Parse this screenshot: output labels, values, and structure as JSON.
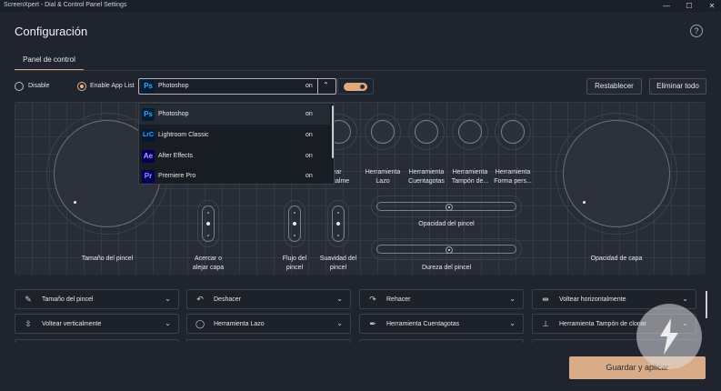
{
  "window": {
    "title": "ScreenXpert - Dial & Control Panel Settings",
    "minimize": "—",
    "maximize": "☐",
    "close": "✕"
  },
  "page": {
    "title": "Configuración",
    "help": "?"
  },
  "tabs": [
    {
      "label": "Panel de control"
    }
  ],
  "mode": {
    "disable_label": "Disable",
    "enable_label": "Enable App List",
    "selected": "enable"
  },
  "app_select": {
    "icon": "Ps",
    "value": "Photoshop",
    "state": "on",
    "chevron": "⌃"
  },
  "toggle": {
    "on": true
  },
  "buttons": {
    "reset": "Restablecer",
    "delete_all": "Eliminar todo",
    "save": "Guardar y aplicar"
  },
  "dropdown": {
    "items": [
      {
        "icon": "Ps",
        "name": "Photoshop",
        "state": "on"
      },
      {
        "icon": "LrC",
        "name": "Lightroom Classic",
        "state": "on"
      },
      {
        "icon": "Ae",
        "name": "After Effects",
        "state": "on"
      },
      {
        "icon": "Pr",
        "name": "Premiere Pro",
        "state": "on"
      }
    ]
  },
  "panel": {
    "left_dial": "Tamaño del pincel",
    "right_dial": "Opacidad de capa",
    "zoom": "Acercar o alejar capa",
    "flow": "Flujo del pincel",
    "smooth": "Suavidad del pincel",
    "small_dials": [
      "Voltear verticalmente",
      "Herramienta Lazo",
      "Herramienta Cuentagotas",
      "Herramienta Tampón de...",
      "Herramienta Forma pers..."
    ],
    "small_dial_partial": "ltear ticalmente",
    "slider1": "Opacidad del pincel",
    "slider2": "Dureza del pincel"
  },
  "actions": [
    {
      "icon": "brush-icon",
      "glyph": "✎",
      "label": "Tamaño del pincel"
    },
    {
      "icon": "undo-icon",
      "glyph": "↶",
      "label": "Deshacer"
    },
    {
      "icon": "redo-icon",
      "glyph": "↷",
      "label": "Rehacer"
    },
    {
      "icon": "flip-horizontal-icon",
      "glyph": "⇹",
      "label": "Voltear horizontalmente"
    },
    {
      "icon": "flip-vertical-icon",
      "glyph": "⇳",
      "label": "Voltear verticalmente"
    },
    {
      "icon": "lasso-icon",
      "glyph": "◯",
      "label": "Herramienta Lazo"
    },
    {
      "icon": "eyedropper-icon",
      "glyph": "✒",
      "label": "Herramienta Cuentagotas"
    },
    {
      "icon": "stamp-icon",
      "glyph": "⊥",
      "label": "Herramienta Tampón de clonar"
    }
  ],
  "action_chevron": "⌄",
  "colors": {
    "accent": "#d9ab86",
    "background": "#1f242e",
    "panel": "#272c36"
  }
}
